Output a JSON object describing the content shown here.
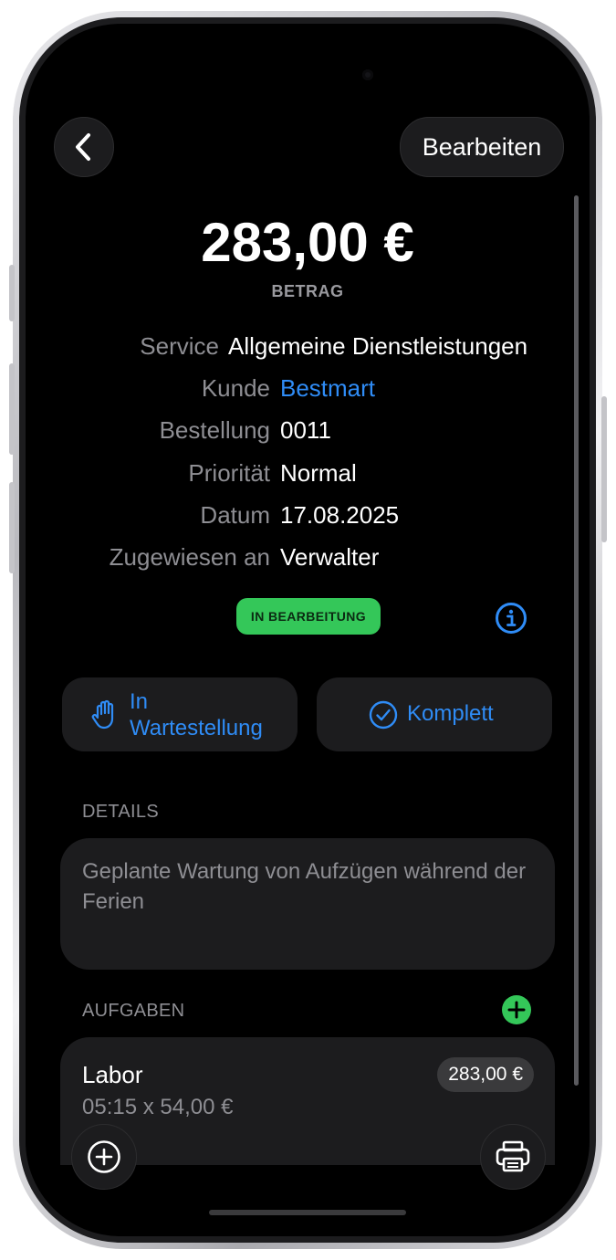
{
  "header": {
    "back_icon": "chevron-left-icon",
    "edit_label": "Bearbeiten"
  },
  "summary": {
    "amount": "283,00 €",
    "amount_label": "BETRAG"
  },
  "info": {
    "service_label": "Service",
    "service_value": "Allgemeine Dienstleistungen",
    "customer_label": "Kunde",
    "customer_value": "Bestmart",
    "order_label": "Bestellung",
    "order_value": "0011",
    "priority_label": "Priorität",
    "priority_value": "Normal",
    "date_label": "Datum",
    "date_value": "17.08.2025",
    "assigned_label": "Zugewiesen an",
    "assigned_value": "Verwalter"
  },
  "status": {
    "badge": "IN BEARBEITUNG",
    "badge_color": "#34c759",
    "info_icon": "info-circle-icon"
  },
  "actions": {
    "hold_line1": "In",
    "hold_line2": "Wartestellung",
    "hold_icon": "hand-raised-icon",
    "complete_label": "Komplett",
    "complete_icon": "checkmark-circle-icon"
  },
  "details": {
    "section_label": "DETAILS",
    "text": "Geplante Wartung von Aufzügen während der Ferien"
  },
  "tasks": {
    "section_label": "AUFGABEN",
    "add_icon": "plus-circle-fill-icon",
    "items": [
      {
        "title": "Labor",
        "subtitle": "05:15 x 54,00 €",
        "price": "283,00 €"
      }
    ]
  },
  "bottom": {
    "add_icon": "plus-circle-icon",
    "print_icon": "printer-icon"
  },
  "colors": {
    "accent": "#2f8cf6",
    "success": "#34c759",
    "background": "#000000",
    "card": "#1c1c1e"
  }
}
